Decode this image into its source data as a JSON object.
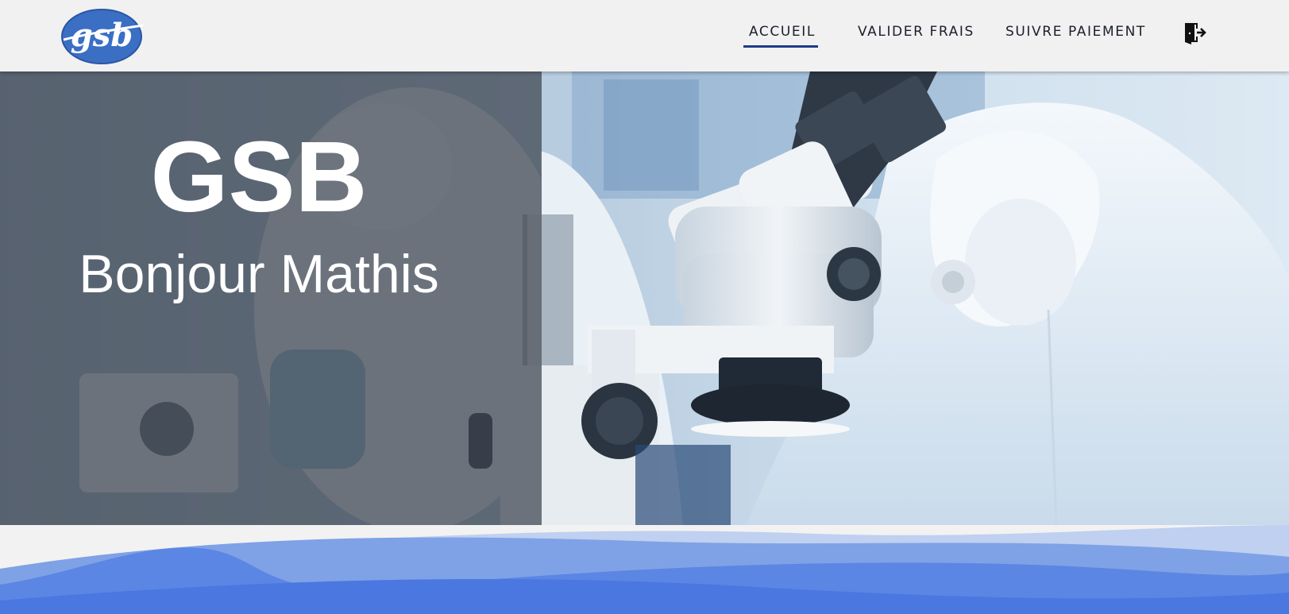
{
  "brand": {
    "logo_text": "gsb",
    "logo_color": "#3a6fc4"
  },
  "nav": {
    "items": [
      {
        "label": "ACCUEIL",
        "active": true
      },
      {
        "label": "VALIDER FRAIS",
        "active": false
      },
      {
        "label": "SUIVRE PAIEMENT",
        "active": false
      }
    ],
    "logout_icon": "logout-door-icon",
    "active_color": "#1e3a8a"
  },
  "hero": {
    "title": "GSB",
    "subtitle": "Bonjour Mathis",
    "image_description_icon": "lab-microscope-photo"
  },
  "colors": {
    "wave_light": "#bfd0f0",
    "wave_mid": "#7fa1e6",
    "wave_dark": "#4a78e0"
  }
}
